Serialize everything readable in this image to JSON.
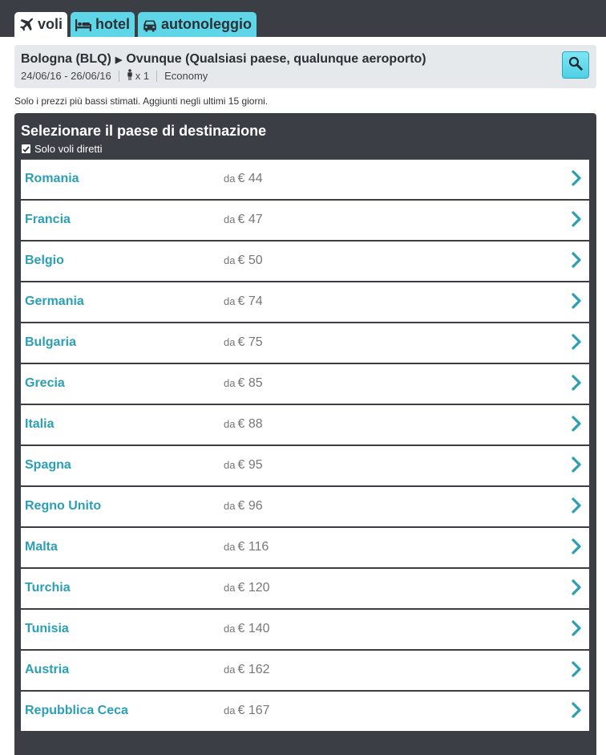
{
  "tabs": [
    {
      "label": "voli",
      "icon": "plane-icon",
      "active": true
    },
    {
      "label": "hotel",
      "icon": "bed-icon",
      "active": false
    },
    {
      "label": "autonoleggio",
      "icon": "car-icon",
      "active": false
    }
  ],
  "search": {
    "origin": "Bologna (BLQ)",
    "destination": "Ovunque (Qualsiasi paese, qualunque aeroporto)",
    "dates": "24/06/16 - 26/06/16",
    "passengers": "x 1",
    "cabin": "Economy",
    "button_icon": "magnifier-icon"
  },
  "note": "Solo i prezzi più bassi stimati. Aggiunti negli ultimi 15 giorni.",
  "panel": {
    "title": "Selezionare il paese di destinazione",
    "direct_only_label": "Solo voli diretti",
    "direct_only_checked": true
  },
  "price_prefix": "da",
  "countries": [
    {
      "name": "Romania",
      "price": "€ 44"
    },
    {
      "name": "Francia",
      "price": "€ 47"
    },
    {
      "name": "Belgio",
      "price": "€ 50"
    },
    {
      "name": "Germania",
      "price": "€ 74"
    },
    {
      "name": "Bulgaria",
      "price": "€ 75"
    },
    {
      "name": "Grecia",
      "price": "€ 85"
    },
    {
      "name": "Italia",
      "price": "€ 88"
    },
    {
      "name": "Spagna",
      "price": "€ 95"
    },
    {
      "name": "Regno Unito",
      "price": "€ 96"
    },
    {
      "name": "Malta",
      "price": "€ 116"
    },
    {
      "name": "Turchia",
      "price": "€ 120"
    },
    {
      "name": "Tunisia",
      "price": "€ 140"
    },
    {
      "name": "Austria",
      "price": "€ 162"
    },
    {
      "name": "Repubblica Ceca",
      "price": "€ 167"
    }
  ],
  "colors": {
    "accent": "#5fd5e8",
    "country_link": "#2a9fb5",
    "dark_bg": "#3b3e45"
  }
}
